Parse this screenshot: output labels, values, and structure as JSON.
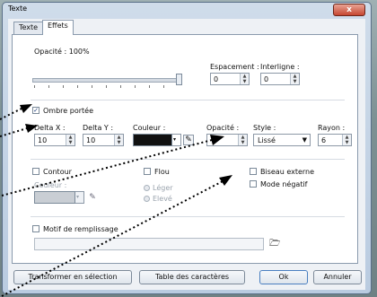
{
  "window": {
    "title": "Texte",
    "close_label": "x"
  },
  "tabs": [
    {
      "label": "Texte"
    },
    {
      "label": "Effets"
    }
  ],
  "opacity": {
    "label": "Opacité : 100%",
    "value_percent": 100
  },
  "spacing": {
    "label": "Espacement :",
    "value": "0"
  },
  "line_spacing": {
    "label": "Interligne :",
    "value": "0"
  },
  "shadow": {
    "checkbox_label": "Ombre portée",
    "checked": true,
    "delta_x": {
      "label": "Delta X :",
      "value": "10"
    },
    "delta_y": {
      "label": "Delta Y :",
      "value": "10"
    },
    "color": {
      "label": "Couleur :",
      "swatch_color": "#111111"
    },
    "opacity": {
      "label": "Opacité :"
    },
    "style": {
      "label": "Style :",
      "value": "Lissé"
    },
    "radius": {
      "label": "Rayon :",
      "value": "6"
    }
  },
  "outline": {
    "checkbox_label": "Contour",
    "color_label": "Couleur :"
  },
  "blur": {
    "checkbox_label": "Flou",
    "option_light": "Léger",
    "option_high": "Elevé"
  },
  "bevel": {
    "checkbox_label": "Biseau externe"
  },
  "negative": {
    "checkbox_label": "Mode négatif"
  },
  "fill_pattern": {
    "checkbox_label": "Motif de remplissage"
  },
  "buttons": {
    "convert": "Transformer en sélection",
    "charmap": "Table des caractères",
    "ok": "Ok",
    "cancel": "Annuler"
  },
  "colors": {
    "accent": "#1a3a78",
    "arrow": "#000000"
  }
}
